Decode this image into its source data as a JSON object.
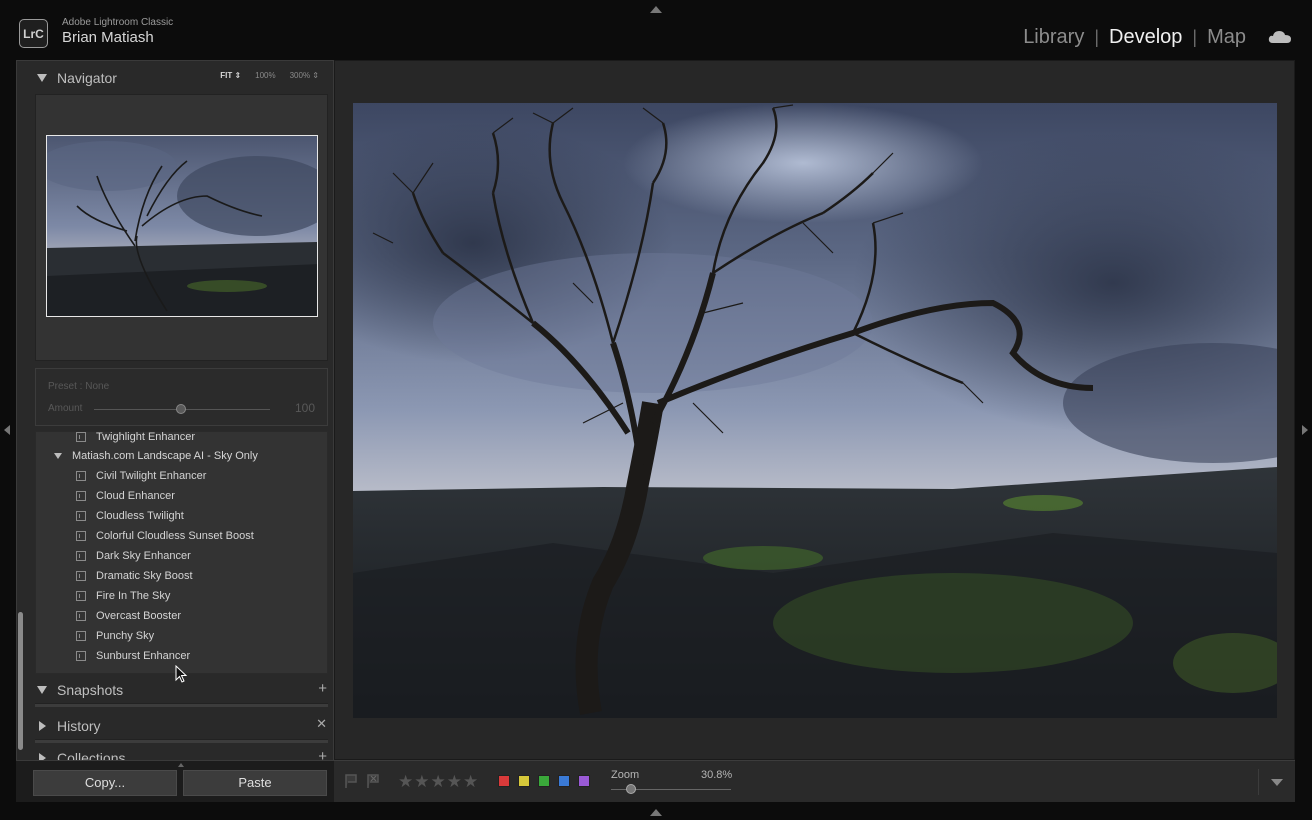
{
  "app": {
    "logo": "LrC",
    "app_name": "Adobe Lightroom Classic",
    "user_name": "Brian Matiash"
  },
  "modules": {
    "items": [
      "Library",
      "Develop",
      "Map"
    ],
    "active": "Develop",
    "cloud_icon": "cloud-icon"
  },
  "navigator": {
    "title": "Navigator",
    "zoom_options": [
      "FIT ⇕",
      "100%",
      "300% ⇕"
    ],
    "selected_zoom": "FIT"
  },
  "preset_amount": {
    "preset_label": "Preset : None",
    "amount_label": "Amount",
    "amount_value": "100",
    "amount_fraction": 0.5
  },
  "presets": {
    "above_item": "Twighlight Enhancer",
    "group_name": "Matiash.com Landscape AI - Sky Only",
    "items": [
      "Civil Twilight Enhancer",
      "Cloud Enhancer",
      "Cloudless Twilight",
      "Colorful Cloudless Sunset Boost",
      "Dark Sky Enhancer",
      "Dramatic Sky Boost",
      "Fire In The Sky",
      "Overcast Booster",
      "Punchy Sky",
      "Sunburst Enhancer"
    ]
  },
  "panels": {
    "snapshots": "Snapshots",
    "history": "History",
    "collections": "Collections"
  },
  "buttons": {
    "copy": "Copy...",
    "paste": "Paste"
  },
  "toolbar": {
    "zoom_label": "Zoom",
    "zoom_value": "30.8%",
    "stars": [
      "★",
      "★",
      "★",
      "★",
      "★"
    ],
    "label_colors": [
      "#d93a3a",
      "#d6c83a",
      "#3aa83a",
      "#3a7ad6",
      "#9a5ad6"
    ]
  }
}
